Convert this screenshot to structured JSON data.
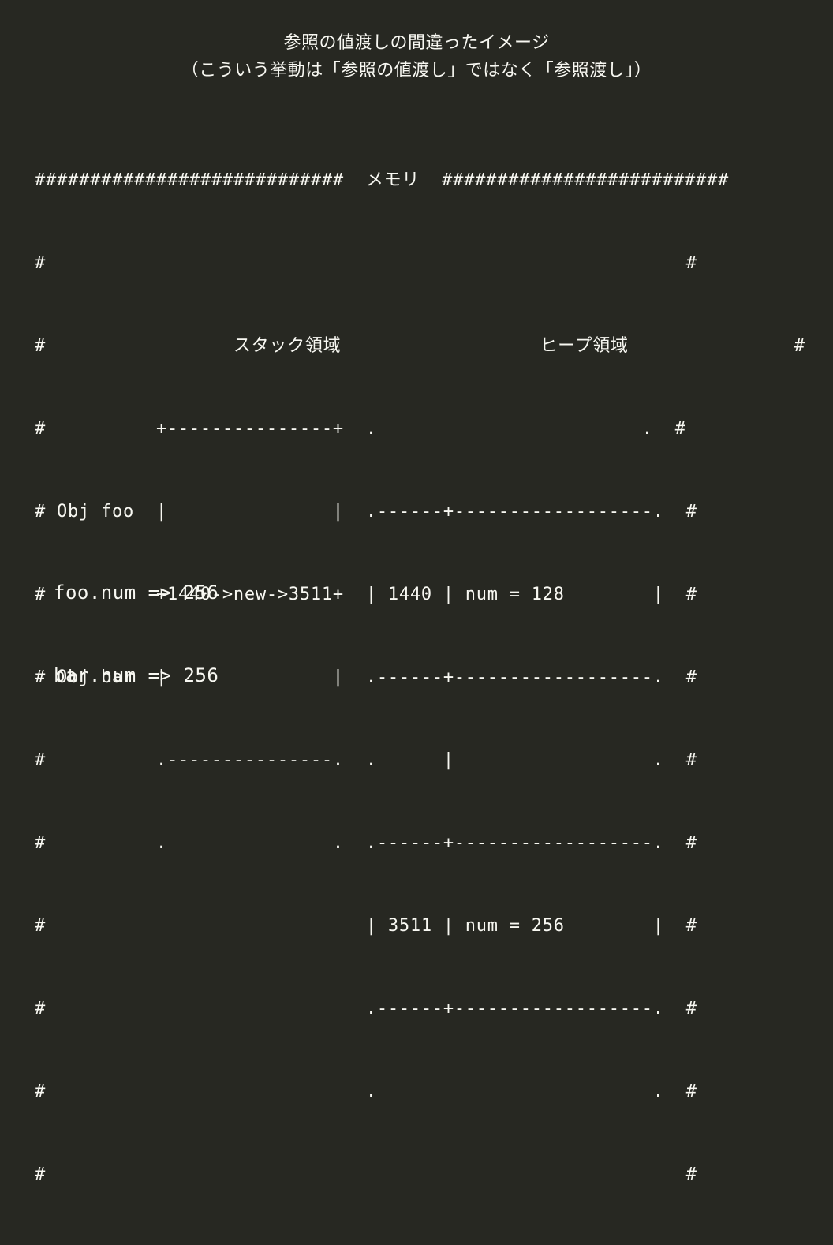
{
  "title": {
    "line1": "参照の値渡しの間違ったイメージ",
    "line2": "（こういう挙動は「参照の値渡し」ではなく「参照渡し」）"
  },
  "memory_diagram": {
    "header_left": "############################",
    "header_label": "メモリ",
    "header_right": " ##########################",
    "rows": [
      "#                                                                       #",
      "#",
      "#          +---------------+  .                        .  #",
      "# Obj foo  |               |  .------+------------------.  #",
      "#          +1440->new->3511+  | 1440 | num = 128        |  #",
      "# Obj bar  |               |  .------+------------------.  #",
      "#          .---------------.  .      |                  .  #",
      "#          .               .  .------+------------------.  #",
      "#                             | 3511 | num = 256        |  #",
      "#                             .------+------------------.  #",
      "#                             .                         .  #",
      "#                                                          #",
      "###########################################################"
    ],
    "stack_label": "スタック領域",
    "heap_label": "ヒープ領域",
    "stack_row_prefix": "#                 ",
    "mid_gap": "                  ",
    "heap_row_suffix": "               #"
  },
  "output_lines": [
    "foo.num => 256",
    "bar.num => 256"
  ]
}
